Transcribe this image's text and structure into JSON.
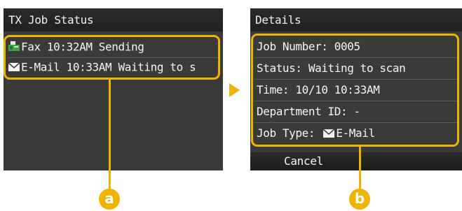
{
  "left_screen": {
    "title": "TX Job Status",
    "jobs": [
      {
        "icon": "fax-icon",
        "text": "Fax 10:32AM  Sending"
      },
      {
        "icon": "email-icon",
        "text": "E-Mail  10:33AM Waiting to s"
      }
    ]
  },
  "right_screen": {
    "title": "Details",
    "rows": [
      "Job Number: 0005",
      "Status: Waiting to scan",
      "Time: 10/10 10:33AM",
      "Department ID: -"
    ],
    "job_type_label": "Job Type:",
    "job_type_value": "E-Mail",
    "cancel_label": "Cancel"
  },
  "callouts": {
    "a": "a",
    "b": "b"
  },
  "colors": {
    "accent": "#f0b400",
    "screen_bg": "#3a3a3a"
  }
}
